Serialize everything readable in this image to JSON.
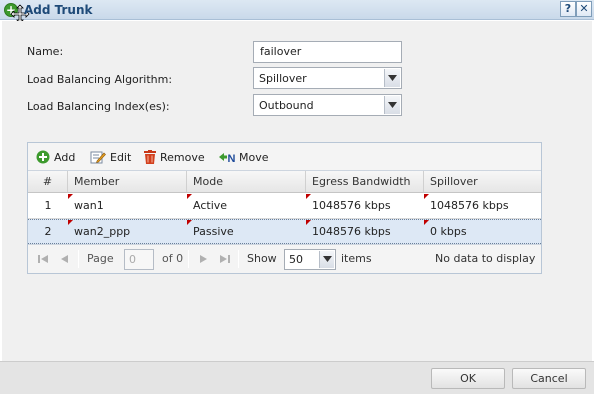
{
  "window": {
    "title": "Add Trunk",
    "help_label": "?",
    "close_label": "✕"
  },
  "form": {
    "name_label": "Name:",
    "name_value": "failover",
    "algorithm_label": "Load Balancing Algorithm:",
    "algorithm_value": "Spillover",
    "index_label": "Load Balancing Index(es):",
    "index_value": "Outbound"
  },
  "toolbar": {
    "add_label": "Add",
    "edit_label": "Edit",
    "remove_label": "Remove",
    "move_label": "Move"
  },
  "table": {
    "columns": [
      "#",
      "Member",
      "Mode",
      "Egress Bandwidth",
      "Spillover"
    ],
    "rows": [
      {
        "num": "1",
        "member": "wan1",
        "mode": "Active",
        "egress": "1048576 kbps",
        "spillover": "1048576 kbps"
      },
      {
        "num": "2",
        "member": "wan2_ppp",
        "mode": "Passive",
        "egress": "1048576 kbps",
        "spillover": "0 kbps"
      }
    ]
  },
  "pager": {
    "page_label": "Page",
    "page_value": "0",
    "of_label": "of 0",
    "show_label": "Show",
    "show_value": "50",
    "items_label": "items",
    "status_text": "No data to display"
  },
  "footer": {
    "ok_label": "OK",
    "cancel_label": "Cancel"
  },
  "colors": {
    "title_text": "#1e4a78",
    "selected_row": "#dde8f5",
    "dirty_marker": "#c00000",
    "add_icon": "#3d9a2e",
    "remove_icon": "#d2401e"
  }
}
